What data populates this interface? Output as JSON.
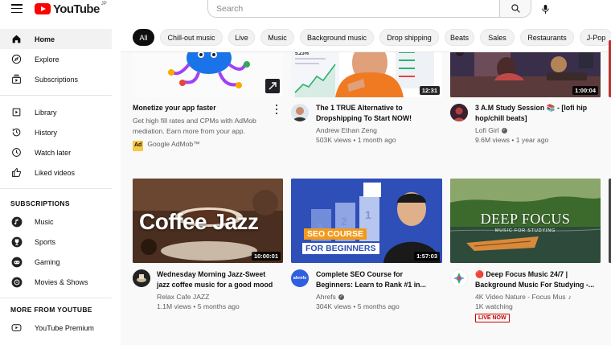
{
  "header": {
    "logo_text": "YouTube",
    "logo_region": "JP",
    "search_placeholder": "Search"
  },
  "sidebar": {
    "main": [
      {
        "label": "Home",
        "icon": "home-icon",
        "active": true
      },
      {
        "label": "Explore",
        "icon": "compass-icon"
      },
      {
        "label": "Subscriptions",
        "icon": "subscriptions-icon"
      }
    ],
    "library": [
      {
        "label": "Library",
        "icon": "library-icon"
      },
      {
        "label": "History",
        "icon": "history-icon"
      },
      {
        "label": "Watch later",
        "icon": "clock-icon"
      },
      {
        "label": "Liked videos",
        "icon": "thumbs-up-icon"
      }
    ],
    "subscriptions_title": "SUBSCRIPTIONS",
    "subscriptions": [
      {
        "label": "Music",
        "icon": "music-icon"
      },
      {
        "label": "Sports",
        "icon": "trophy-icon"
      },
      {
        "label": "Gaming",
        "icon": "gaming-icon"
      },
      {
        "label": "Movies & Shows",
        "icon": "film-icon"
      }
    ],
    "more_title": "MORE FROM YOUTUBE",
    "more": [
      {
        "label": "YouTube Premium",
        "icon": "youtube-premium-icon"
      }
    ]
  },
  "chips": [
    "All",
    "Chill-out music",
    "Live",
    "Music",
    "Background music",
    "Drop shipping",
    "Beats",
    "Sales",
    "Restaurants",
    "J-Pop"
  ],
  "videos": {
    "ad": {
      "title": "Monetize your app faster",
      "description": "Get high fill rates and CPMs with AdMob mediation. Earn more from your app.",
      "ad_label": "Ad",
      "advertiser": "Google AdMob™"
    },
    "dropship": {
      "title": "The 1 TRUE Alternative to Dropshipping To Start NOW!",
      "channel": "Andrew Ethan Zeng",
      "meta": "503K views • 1 month ago",
      "duration": "12:31",
      "thumb_stat": "5.23%"
    },
    "lofi": {
      "title": "3 A.M Study Session 📚 - [lofi hip hop/chill beats]",
      "channel": "Lofi Girl",
      "meta": "9.6M views • 1 year ago",
      "duration": "1:00:04"
    },
    "coffee": {
      "title": "Wednesday Morning Jazz-Sweet jazz coffee music for a good mood",
      "channel": "Relax Cafe JAZZ",
      "meta": "1.1M views • 5 months ago",
      "duration": "10:00:01",
      "thumb_text": "Coffee Jazz"
    },
    "seo": {
      "title": "Complete SEO Course for Beginners: Learn to Rank #1 in...",
      "channel": "Ahrefs",
      "meta": "304K views • 5 months ago",
      "duration": "1:57:03",
      "thumb_line1": "SEO COURSE",
      "thumb_line2": "FOR BEGINNERS",
      "avatar_text": "ahrefs"
    },
    "focus": {
      "title": "🔴 Deep Focus Music 24/7 | Background Music For Studying -...",
      "channel": "4K Video Nature - Focus Mus",
      "meta": "1K watching",
      "live_label": "LIVE NOW",
      "thumb_text": "DEEP FOCUS",
      "thumb_subtext": "MUSIC FOR STUDYING"
    }
  },
  "colors": {
    "brand_red": "#ff0000",
    "chip_active": "#0f0f0f",
    "text_secondary": "#606060"
  }
}
